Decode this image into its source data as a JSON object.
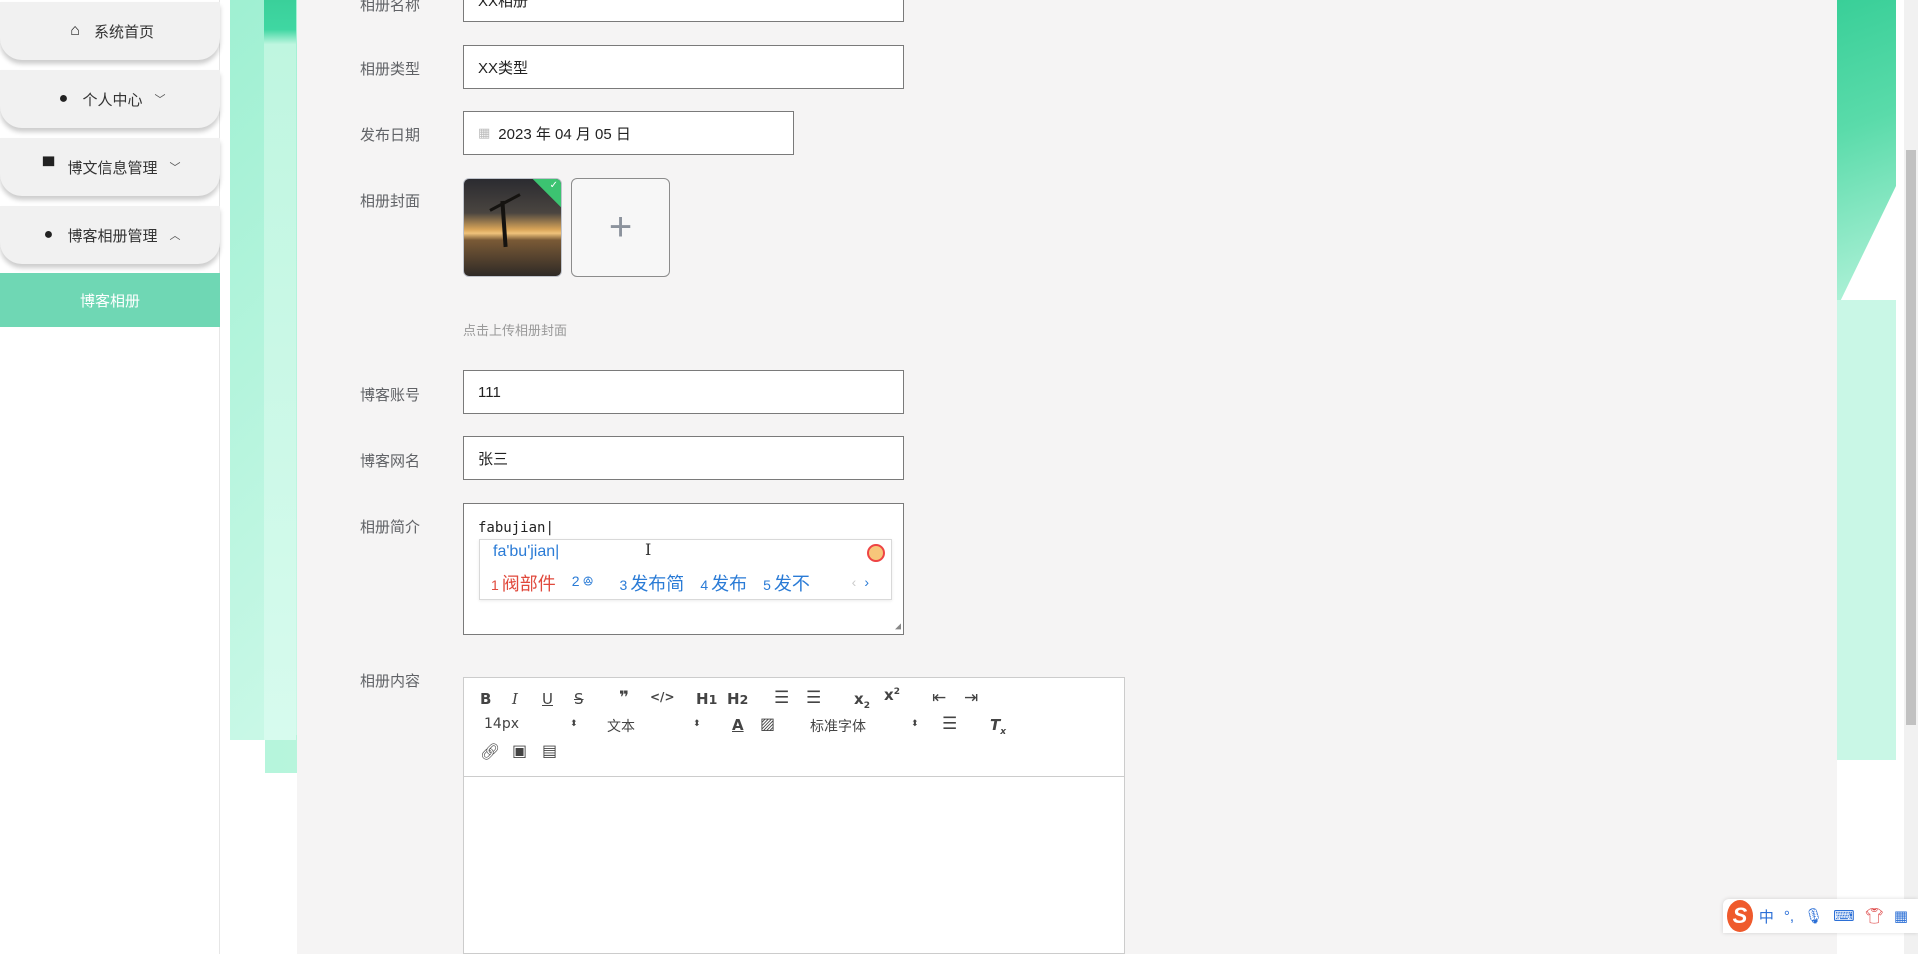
{
  "sidebar": {
    "items": [
      {
        "label": "系统首页",
        "icon": "home-icon"
      },
      {
        "label": "个人中心",
        "icon": "user-icon"
      },
      {
        "label": "博文信息管理",
        "icon": "brush-icon"
      },
      {
        "label": "博客相册管理",
        "icon": "user-icon"
      }
    ],
    "active_sub": "博客相册"
  },
  "form": {
    "album_name": {
      "label": "相册名称",
      "value": "XX相册"
    },
    "album_type": {
      "label": "相册类型",
      "value": "XX类型"
    },
    "publish_date": {
      "label": "发布日期",
      "value": "2023 年 04 月 05 日"
    },
    "cover": {
      "label": "相册封面",
      "hint": "点击上传相册封面",
      "add": "+"
    },
    "account": {
      "label": "博客账号",
      "value": "111"
    },
    "nickname": {
      "label": "博客网名",
      "value": "张三"
    },
    "intro": {
      "label": "相册简介",
      "value": "fabujian"
    },
    "content": {
      "label": "相册内容"
    }
  },
  "ime": {
    "pinyin": "fa'bu'jian",
    "candidates": [
      {
        "n": "1",
        "text": "阀部件"
      },
      {
        "n": "2",
        "text": "ꔮ"
      },
      {
        "n": "3",
        "text": "发布简"
      },
      {
        "n": "4",
        "text": "发布"
      },
      {
        "n": "5",
        "text": "发不"
      }
    ]
  },
  "editor": {
    "font_size": "14px",
    "header": "文本",
    "font_family": "标准字体"
  },
  "tray": {
    "zh": "中",
    "punct": "°,"
  },
  "colors": {
    "accent": "#6fd7b4",
    "mint": "#9ff0d2",
    "ime_blue": "#2a7bd6"
  }
}
